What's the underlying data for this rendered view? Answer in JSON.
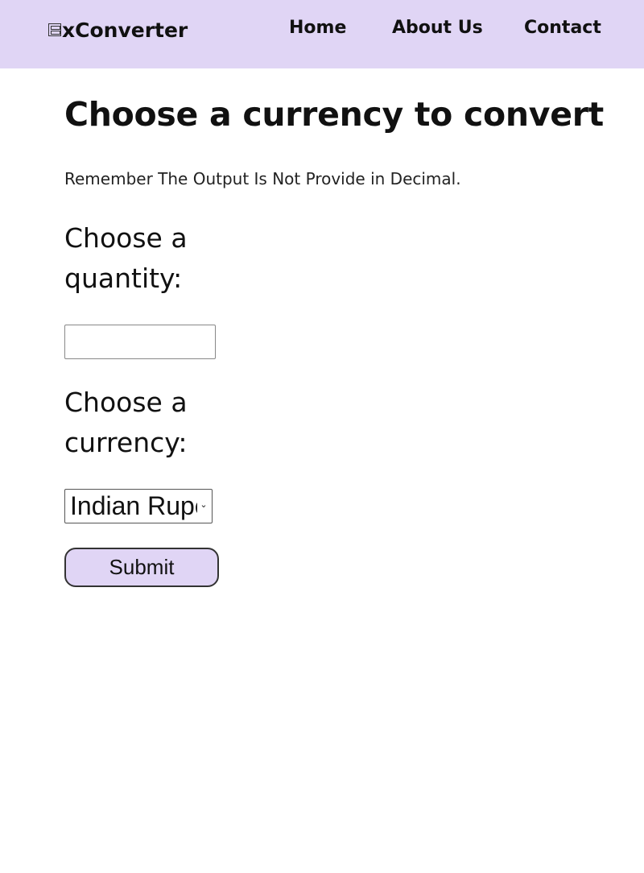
{
  "header": {
    "brand_icon": "currency-exchange-icon",
    "brand_name": "xConverter",
    "nav": {
      "home": "Home",
      "about": "About Us",
      "contact": "Contact"
    },
    "background_color": "#e0d5f5"
  },
  "main": {
    "title": "Choose a currency to convert",
    "note": "Remember The Output Is Not Provide in Decimal.",
    "quantity_label": "Choose a quantity:",
    "quantity_value": "",
    "currency_label": "Choose a currency:",
    "currency_selected": "Indian Rupee",
    "currency_chevron": "⌄",
    "submit_label": "Submit"
  }
}
